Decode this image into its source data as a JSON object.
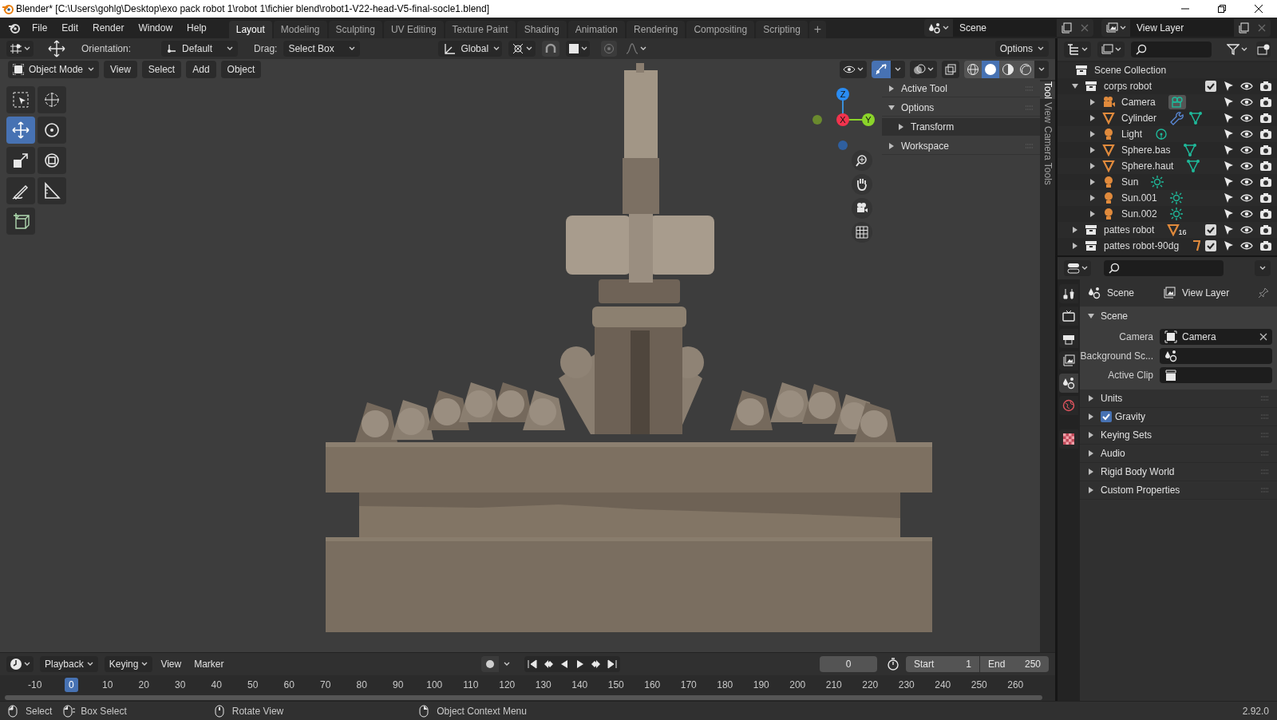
{
  "title_bar": {
    "title": "Blender* [C:\\Users\\gohlg\\Desktop\\exo pack robot 1\\robot 1\\fichier blend\\robot1-V22-head-V5-final-socle1.blend]"
  },
  "menu": [
    "File",
    "Edit",
    "Render",
    "Window",
    "Help"
  ],
  "workspaces": [
    {
      "label": "Layout",
      "selected": true
    },
    {
      "label": "Modeling",
      "selected": false
    },
    {
      "label": "Sculpting",
      "selected": false
    },
    {
      "label": "UV Editing",
      "selected": false
    },
    {
      "label": "Texture Paint",
      "selected": false
    },
    {
      "label": "Shading",
      "selected": false
    },
    {
      "label": "Animation",
      "selected": false
    },
    {
      "label": "Rendering",
      "selected": false
    },
    {
      "label": "Compositing",
      "selected": false
    },
    {
      "label": "Scripting",
      "selected": false
    }
  ],
  "add_workspace": "+",
  "scene": "Scene",
  "view_layer": "View Layer",
  "viewport": {
    "orientation_label": "Orientation:",
    "orientation": "Default",
    "drag_label": "Drag:",
    "drag": "Select Box",
    "transform_orientation": "Global",
    "options": "Options",
    "mode": "Object Mode",
    "menus": [
      "View",
      "Select",
      "Add",
      "Object"
    ],
    "tools": [
      {
        "kind": "select-box",
        "selected": false
      },
      {
        "kind": "cursor",
        "selected": false
      },
      {
        "kind": "move",
        "selected": true
      },
      {
        "kind": "rotate",
        "selected": false
      },
      {
        "kind": "scale",
        "selected": false
      },
      {
        "kind": "transform",
        "selected": false
      },
      {
        "kind": "annotate",
        "selected": false
      },
      {
        "kind": "measure",
        "selected": false
      },
      {
        "kind": "add-cube",
        "selected": false
      }
    ],
    "gizmos_on": true,
    "shading": [
      {
        "kind": "wireframe",
        "selected": false
      },
      {
        "kind": "solid",
        "selected": true
      },
      {
        "kind": "material",
        "selected": false
      },
      {
        "kind": "rendered",
        "selected": false
      }
    ],
    "axes": {
      "z": "Z",
      "x": "X",
      "y": "Y"
    },
    "sidebar": {
      "tabs": [
        {
          "label": "Tool",
          "selected": true
        },
        {
          "label": "View",
          "selected": false
        },
        {
          "label": "Camera Tools",
          "selected": false
        }
      ],
      "panels": [
        {
          "label": "Active Tool",
          "expanded": false
        },
        {
          "label": "Options",
          "expanded": true,
          "children": [
            {
              "label": "Transform",
              "expanded": false
            }
          ]
        },
        {
          "label": "Workspace",
          "expanded": false
        }
      ]
    }
  },
  "outliner": {
    "root": "Scene Collection",
    "items": [
      {
        "kind": "collection",
        "label": "corps robot",
        "expanded": true,
        "checked": true,
        "children": [
          {
            "kind": "camera",
            "label": "Camera",
            "expanded": false
          },
          {
            "kind": "mesh-modified",
            "label": "Cylinder",
            "expanded": false
          },
          {
            "kind": "point-light",
            "label": "Light",
            "expanded": false
          },
          {
            "kind": "mesh",
            "label": "Sphere.bas",
            "expanded": false
          },
          {
            "kind": "mesh",
            "label": "Sphere.haut",
            "expanded": false
          },
          {
            "kind": "sun",
            "label": "Sun",
            "expanded": false
          },
          {
            "kind": "sun",
            "label": "Sun.001",
            "expanded": false
          },
          {
            "kind": "sun",
            "label": "Sun.002",
            "expanded": false
          }
        ]
      },
      {
        "kind": "collection",
        "label": "pattes robot",
        "expanded": false,
        "checked": true,
        "badge": "16"
      },
      {
        "kind": "collection",
        "label": "pattes robot-90dg",
        "expanded": false,
        "checked": true
      }
    ]
  },
  "properties": {
    "tabs": [
      {
        "kind": "tool",
        "selected": false
      },
      {
        "kind": "render",
        "selected": false
      },
      {
        "kind": "output",
        "selected": false
      },
      {
        "kind": "view-layer",
        "selected": false
      },
      {
        "kind": "scene",
        "selected": true
      },
      {
        "kind": "world",
        "selected": false
      },
      {
        "kind": "texture",
        "selected": false
      }
    ],
    "breadcrumb": [
      "Scene",
      "View Layer"
    ],
    "panel": {
      "label": "Scene",
      "expanded": true,
      "fields": [
        {
          "kind": "camera",
          "label": "Camera",
          "value": "Camera"
        },
        {
          "kind": "scene",
          "label": "Background Sc..."
        },
        {
          "kind": "clip",
          "label": "Active Clip"
        }
      ]
    },
    "subpanels": [
      {
        "kind": "plain",
        "label": "Units",
        "expanded": false
      },
      {
        "kind": "checkbox",
        "label": "Gravity",
        "expanded": false,
        "checked": true
      },
      {
        "kind": "plain",
        "label": "Keying Sets",
        "expanded": false
      },
      {
        "kind": "plain",
        "label": "Audio",
        "expanded": false
      },
      {
        "kind": "plain",
        "label": "Rigid Body World",
        "expanded": false
      },
      {
        "kind": "plain",
        "label": "Custom Properties",
        "expanded": false
      }
    ]
  },
  "timeline": {
    "menus": [
      "Playback",
      "Keying",
      "View",
      "Marker"
    ],
    "current_frame": "0",
    "start_label": "Start",
    "start": "1",
    "end_label": "End",
    "end": "250",
    "ticks": [
      {
        "label": "-10",
        "selected": false
      },
      {
        "label": "0",
        "selected": true
      },
      {
        "label": "10",
        "selected": false
      },
      {
        "label": "20",
        "selected": false
      },
      {
        "label": "30",
        "selected": false
      },
      {
        "label": "40",
        "selected": false
      },
      {
        "label": "50",
        "selected": false
      },
      {
        "label": "60",
        "selected": false
      },
      {
        "label": "70",
        "selected": false
      },
      {
        "label": "80",
        "selected": false
      },
      {
        "label": "90",
        "selected": false
      },
      {
        "label": "100",
        "selected": false
      },
      {
        "label": "110",
        "selected": false
      },
      {
        "label": "120",
        "selected": false
      },
      {
        "label": "130",
        "selected": false
      },
      {
        "label": "140",
        "selected": false
      },
      {
        "label": "150",
        "selected": false
      },
      {
        "label": "160",
        "selected": false
      },
      {
        "label": "170",
        "selected": false
      },
      {
        "label": "180",
        "selected": false
      },
      {
        "label": "190",
        "selected": false
      },
      {
        "label": "200",
        "selected": false
      },
      {
        "label": "210",
        "selected": false
      },
      {
        "label": "220",
        "selected": false
      },
      {
        "label": "230",
        "selected": false
      },
      {
        "label": "240",
        "selected": false
      },
      {
        "label": "250",
        "selected": false
      },
      {
        "label": "260",
        "selected": false
      }
    ]
  },
  "status_bar": {
    "items": [
      {
        "kind": "left",
        "label": "Select"
      },
      {
        "kind": "drag",
        "label": "Box Select"
      },
      {
        "kind": "middle",
        "label": "Rotate View"
      },
      {
        "kind": "right",
        "label": "Object Context Menu"
      }
    ],
    "version": "2.92.0"
  }
}
